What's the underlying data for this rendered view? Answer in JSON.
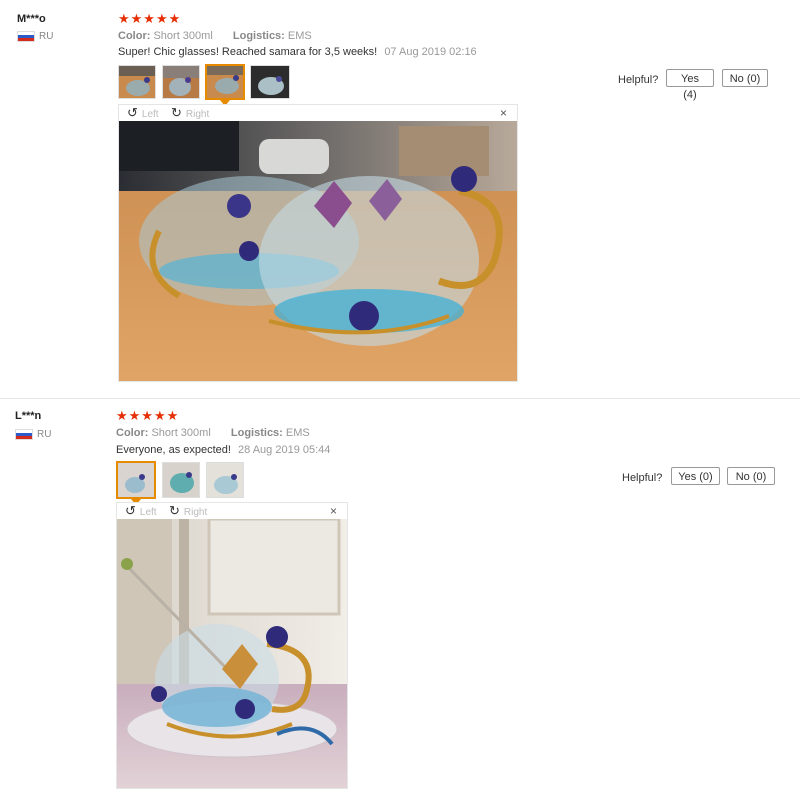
{
  "reviews": [
    {
      "user": "M***o",
      "country": "RU",
      "stars": "★★★★★",
      "color_label": "Color:",
      "color_value": "Short 300ml",
      "logistics_label": "Logistics:",
      "logistics_value": "EMS",
      "text": "Super! Chic glasses! Reached samara for 3,5 weeks!",
      "date": "07 Aug 2019 02:16",
      "helpful_label": "Helpful?",
      "yes_label": "Yes (4)",
      "no_label": "No (0)",
      "viewer": {
        "left_label": "Left",
        "right_label": "Right",
        "close_label": "×"
      },
      "thumbnail_count": 4,
      "selected_thumbnail": 3
    },
    {
      "user": "L***n",
      "country": "RU",
      "stars": "★★★★★",
      "color_label": "Color:",
      "color_value": "Short 300ml",
      "logistics_label": "Logistics:",
      "logistics_value": "EMS",
      "text": "Everyone, as expected!",
      "date": "28 Aug 2019 05:44",
      "helpful_label": "Helpful?",
      "yes_label": "Yes (0)",
      "no_label": "No (0)",
      "viewer": {
        "left_label": "Left",
        "right_label": "Right",
        "close_label": "×"
      },
      "thumbnail_count": 3,
      "selected_thumbnail": 1
    }
  ],
  "icons": {
    "rotate_left": "↺",
    "rotate_right": "↻",
    "flag": "russia-flag-icon"
  },
  "colors": {
    "star": "#e62e04",
    "selected_border": "#e68a00"
  }
}
